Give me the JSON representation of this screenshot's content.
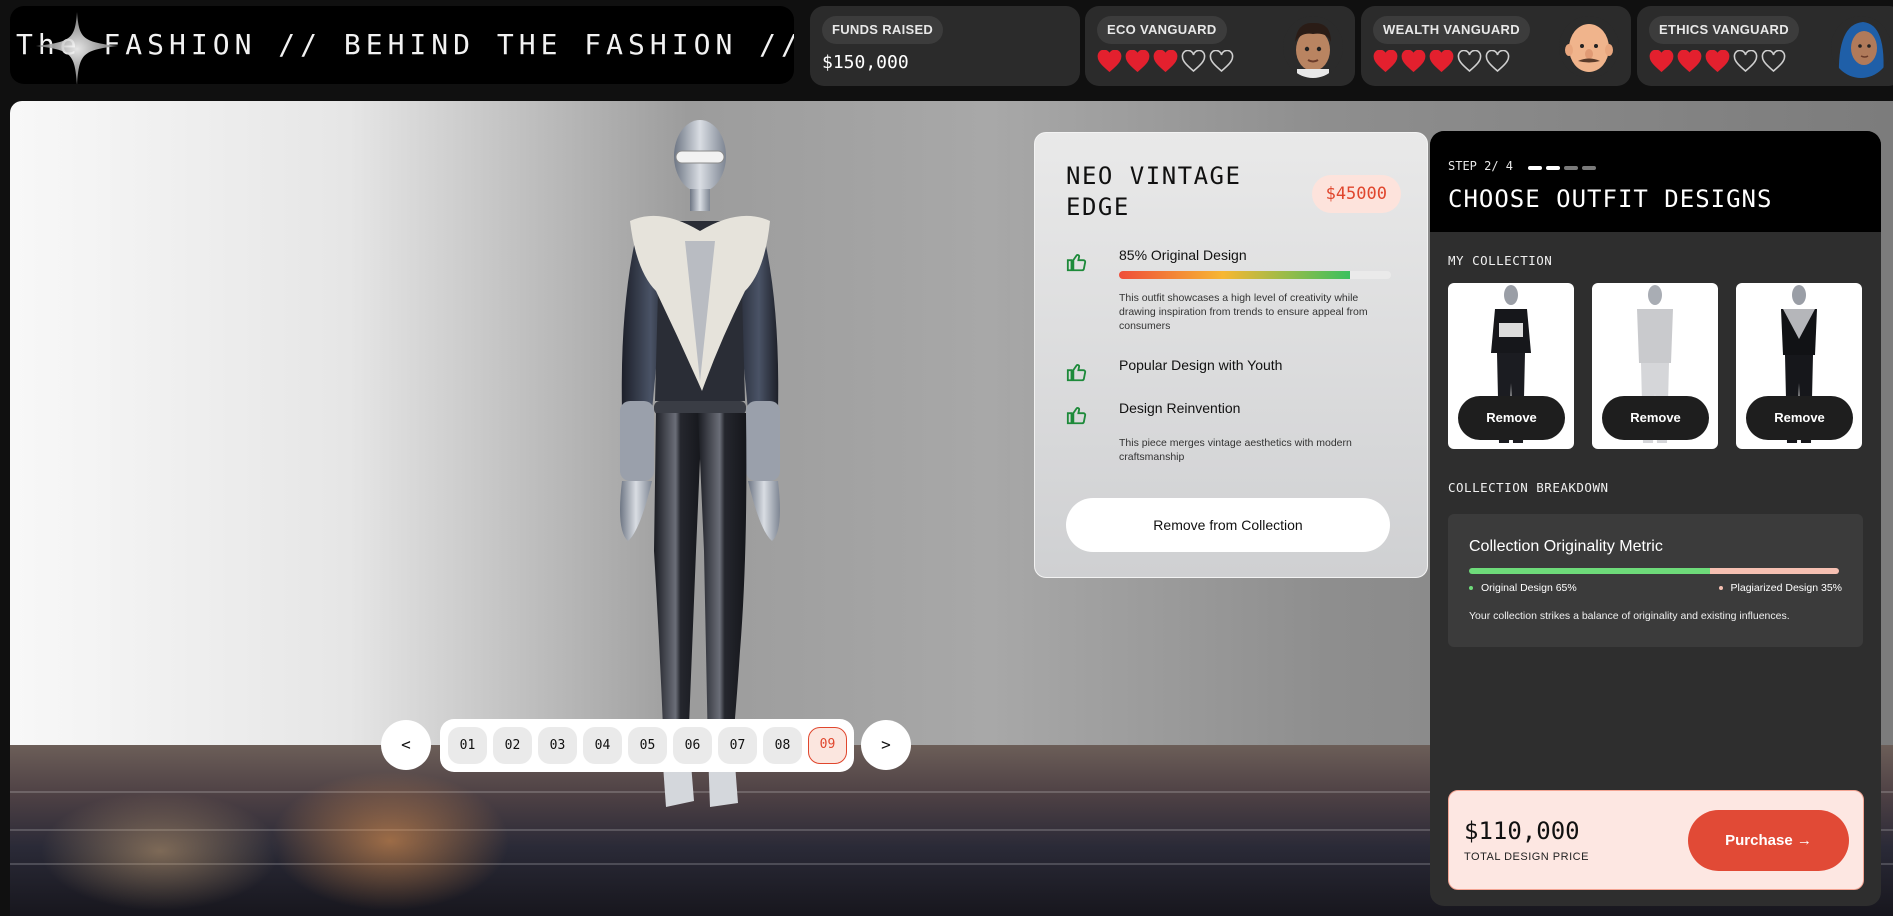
{
  "header": {
    "marquee_text": "The FASHION // BEHIND THE FASHION // BEHI",
    "funds": {
      "label": "FUNDS RAISED",
      "value": "$150,000"
    },
    "vanguards": [
      {
        "label": "ECO VANGUARD",
        "hearts_filled": 3,
        "hearts_total": 5,
        "avatar": "eco-avatar"
      },
      {
        "label": "WEALTH VANGUARD",
        "hearts_filled": 3,
        "hearts_total": 5,
        "avatar": "wealth-avatar"
      },
      {
        "label": "ETHICS VANGUARD",
        "hearts_filled": 3,
        "hearts_total": 5,
        "avatar": "ethics-avatar"
      }
    ]
  },
  "pager": {
    "prev": "<",
    "next": ">",
    "pages": [
      "01",
      "02",
      "03",
      "04",
      "05",
      "06",
      "07",
      "08",
      "09"
    ],
    "active": "09"
  },
  "detail": {
    "title": "NEO VINTAGE EDGE",
    "price": "$45000",
    "originality_percent": 85,
    "features": [
      {
        "name": "85% Original Design",
        "icon": "thumbs-up-icon",
        "desc": "This outfit showcases a high level of creativity while drawing inspiration from trends to ensure appeal from consumers"
      },
      {
        "name": "Popular Design with Youth",
        "icon": "thumbs-up-icon",
        "desc": ""
      },
      {
        "name": "Design Reinvention",
        "icon": "thumbs-up-icon",
        "desc": "This piece merges vintage aesthetics with modern craftsmanship"
      }
    ],
    "remove_label": "Remove from Collection"
  },
  "panel": {
    "step": "STEP 2/ 4",
    "steps_total": 4,
    "step_current": 2,
    "title": "CHOOSE OUTFIT DESIGNS",
    "collection_label": "MY COLLECTION",
    "items": [
      {
        "remove_label": "Remove",
        "outfit": "black-outfit"
      },
      {
        "remove_label": "Remove",
        "outfit": "white-outfit"
      },
      {
        "remove_label": "Remove",
        "outfit": "black-silver-outfit"
      }
    ],
    "breakdown_label": "COLLECTION BREAKDOWN",
    "metric": {
      "title": "Collection Originality Metric",
      "original_label": "Original Design 65%",
      "plagiarized_label": "Plagiarized Design 35%",
      "original_percent": 65,
      "note": "Your collection strikes a balance of originality and existing influences."
    },
    "total": {
      "amount": "$110,000",
      "label": "TOTAL DESIGN PRICE",
      "purchase_label": "Purchase →"
    }
  },
  "colors": {
    "accent": "#e14a36",
    "heart": "#e3202e",
    "original": "#6edb7a",
    "plagiarized": "#f6c0b2"
  }
}
